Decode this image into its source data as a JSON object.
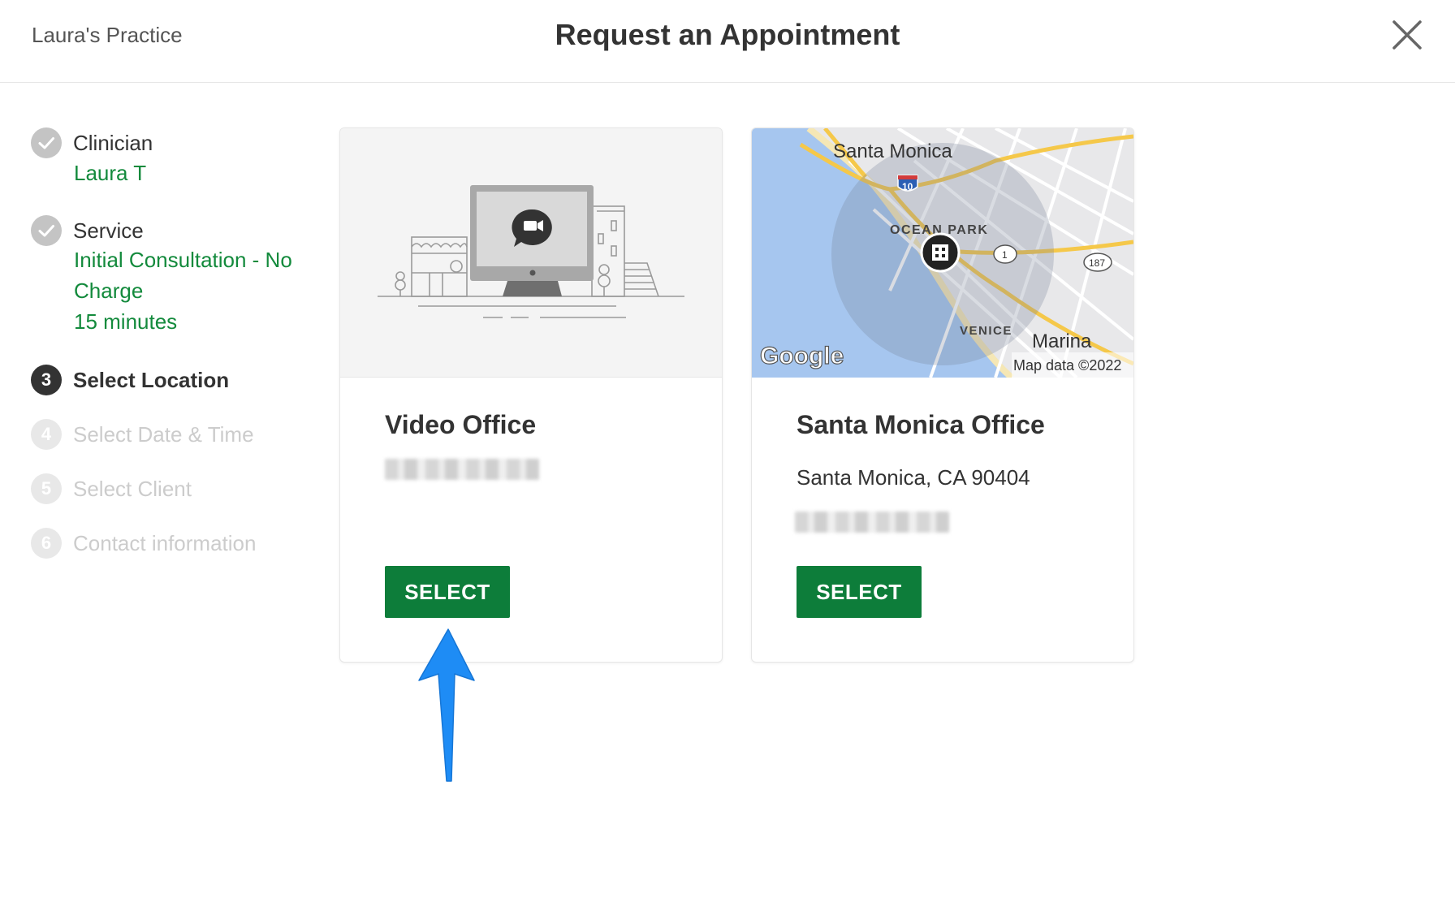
{
  "header": {
    "practice_name": "Laura's Practice",
    "title": "Request an Appointment",
    "close_icon": "close-icon"
  },
  "steps": [
    {
      "number": "1",
      "label": "Clinician",
      "status": "done",
      "sub": [
        "Laura T"
      ]
    },
    {
      "number": "2",
      "label": "Service",
      "status": "done",
      "sub": [
        "Initial Consultation - No",
        "Charge",
        "15 minutes"
      ]
    },
    {
      "number": "3",
      "label": "Select Location",
      "status": "active",
      "sub": []
    },
    {
      "number": "4",
      "label": "Select Date & Time",
      "status": "pending",
      "sub": []
    },
    {
      "number": "5",
      "label": "Select Client",
      "status": "pending",
      "sub": []
    },
    {
      "number": "6",
      "label": "Contact information",
      "status": "pending",
      "sub": []
    }
  ],
  "locations": [
    {
      "name": "Video Office",
      "address": "",
      "select_label": "SELECT"
    },
    {
      "name": "Santa Monica Office",
      "address": "Santa Monica, CA 90404",
      "select_label": "SELECT"
    }
  ],
  "map": {
    "labels": {
      "city": "Santa Monica",
      "ocean_park": "OCEAN PARK",
      "venice": "VENICE",
      "marina": "Marina",
      "hwy10": "10",
      "hwy1": "1",
      "hwy187": "187",
      "logo": "Google",
      "attribution": "Map data ©2022"
    }
  },
  "colors": {
    "accent_green": "#0d7d3a",
    "link_green": "#138a3c",
    "annotation_arrow": "#1e8cf5"
  }
}
